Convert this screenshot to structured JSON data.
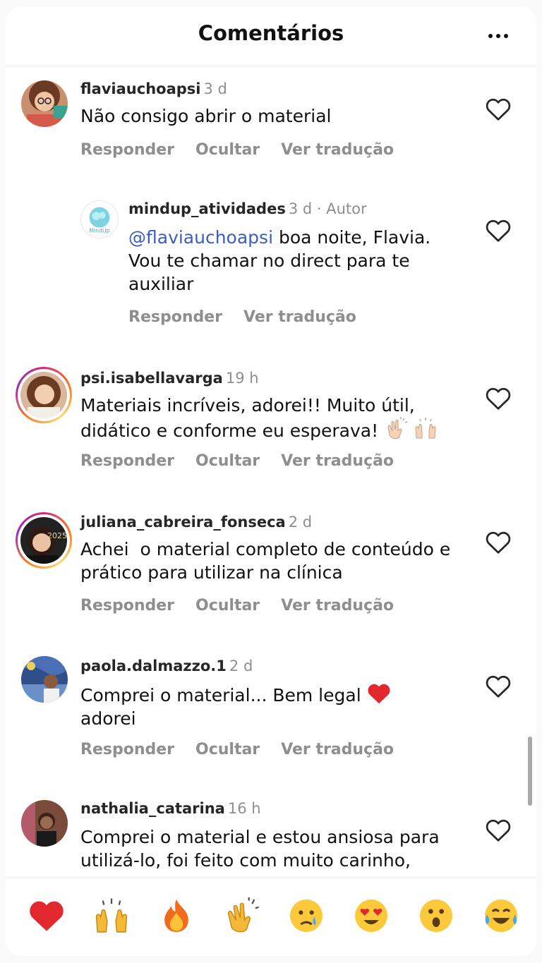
{
  "header": {
    "title": "Comentários"
  },
  "comments": [
    {
      "username": "flaviauchoapsi",
      "time": "3 d",
      "text": "Não consigo abrir o material",
      "actions": [
        "Responder",
        "Ocultar",
        "Ver tradução"
      ]
    },
    {
      "username": "mindup_atividades",
      "time": "3 d · Autor",
      "mention": "@flaviauchoapsi",
      "text": " boa noite, Flavia. Vou te chamar no direct para te auxiliar",
      "actions": [
        "Responder",
        "Ver tradução"
      ],
      "avatar_label": "MindUp"
    },
    {
      "username": "psi.isabellavarga",
      "time": "19 h",
      "text": "Materiais incríveis, adorei!! Muito útil, didático e conforme eu esperava!",
      "actions": [
        "Responder",
        "Ocultar",
        "Ver tradução"
      ]
    },
    {
      "username": "juliana_cabreira_fonseca",
      "time": "2 d",
      "text": "Achei  o material completo de conteúdo e prático para utilizar na clínica",
      "actions": [
        "Responder",
        "Ocultar",
        "Ver tradução"
      ],
      "avatar_label": "2025"
    },
    {
      "username": "paola.dalmazzo.1",
      "time": "2 d",
      "text": "Comprei o material... Bem legal",
      "text2": "adorei",
      "actions": [
        "Responder",
        "Ocultar",
        "Ver tradução"
      ]
    },
    {
      "username": "nathalia_catarina",
      "time": "16 h",
      "text": "Comprei o material e estou ansiosa para utilizá-lo, foi feito com muito carinho,"
    }
  ],
  "emoji_bar": [
    "heart",
    "raising-hands",
    "fire",
    "clapping-hands",
    "crying-face",
    "heart-eyes-face",
    "surprised-face",
    "tears-of-joy-face"
  ],
  "colors": {
    "mention": "#3b5fc0",
    "muted": "#8e8e8e",
    "heart_red": "#e0282e"
  }
}
